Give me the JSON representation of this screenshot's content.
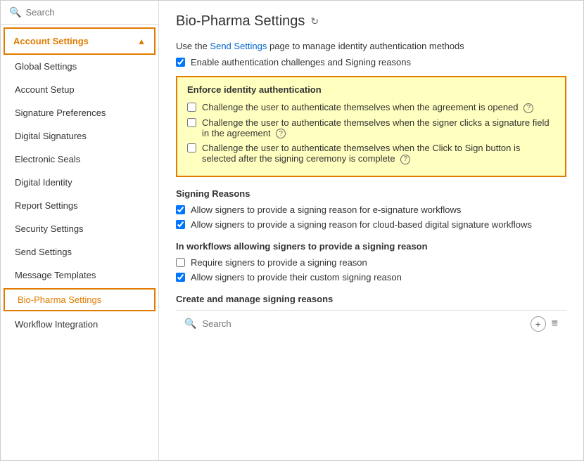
{
  "window": {
    "title": "Bio-Pharma Settings"
  },
  "sidebar": {
    "search_placeholder": "Search",
    "account_settings_label": "Account Settings",
    "nav_items": [
      {
        "id": "global-settings",
        "label": "Global Settings",
        "active": false
      },
      {
        "id": "account-setup",
        "label": "Account Setup",
        "active": false
      },
      {
        "id": "signature-preferences",
        "label": "Signature Preferences",
        "active": false
      },
      {
        "id": "digital-signatures",
        "label": "Digital Signatures",
        "active": false
      },
      {
        "id": "electronic-seals",
        "label": "Electronic Seals",
        "active": false
      },
      {
        "id": "digital-identity",
        "label": "Digital Identity",
        "active": false
      },
      {
        "id": "report-settings",
        "label": "Report Settings",
        "active": false
      },
      {
        "id": "security-settings",
        "label": "Security Settings",
        "active": false
      },
      {
        "id": "send-settings",
        "label": "Send Settings",
        "active": false
      },
      {
        "id": "message-templates",
        "label": "Message Templates",
        "active": false
      },
      {
        "id": "bio-pharma-settings",
        "label": "Bio-Pharma Settings",
        "active": true
      },
      {
        "id": "workflow-integration",
        "label": "Workflow Integration",
        "active": false
      }
    ]
  },
  "main": {
    "page_title": "Bio-Pharma Settings",
    "refresh_icon": "↻",
    "intro_text": "Use the Send Settings page to manage identity authentication methods",
    "send_settings_link": "Send Settings",
    "enable_auth_label": "Enable authentication challenges and Signing reasons",
    "enforce_section": {
      "title": "Enforce identity authentication",
      "items": [
        {
          "id": "challenge-open",
          "label": "Challenge the user to authenticate themselves when the agreement is opened",
          "checked": false,
          "has_help": true
        },
        {
          "id": "challenge-signature",
          "label": "Challenge the user to authenticate themselves when the signer clicks a signature field in the agreement",
          "checked": false,
          "has_help": true
        },
        {
          "id": "challenge-click-to-sign",
          "label": "Challenge the user to authenticate themselves when the Click to Sign button is selected after the signing ceremony is complete",
          "checked": false,
          "has_help": true
        }
      ]
    },
    "signing_reasons_section": {
      "title": "Signing Reasons",
      "items": [
        {
          "id": "allow-esig",
          "label": "Allow signers to provide a signing reason for e-signature workflows",
          "checked": true
        },
        {
          "id": "allow-cloud",
          "label": "Allow signers to provide a signing reason for cloud-based digital signature workflows",
          "checked": true
        }
      ]
    },
    "in_workflows_section": {
      "title": "In workflows allowing signers to provide a signing reason",
      "items": [
        {
          "id": "require-signing-reason",
          "label": "Require signers to provide a signing reason",
          "checked": false
        },
        {
          "id": "allow-custom-reason",
          "label": "Allow signers to provide their custom signing reason",
          "checked": true
        }
      ]
    },
    "create_manage_section": {
      "title": "Create and manage signing reasons"
    },
    "bottom_search": {
      "placeholder": "Search",
      "add_icon": "+",
      "menu_icon": "≡"
    }
  }
}
